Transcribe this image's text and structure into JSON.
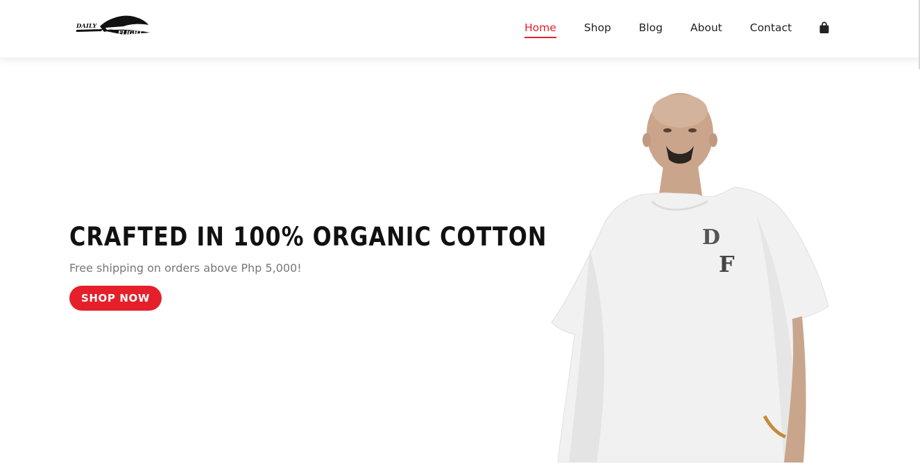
{
  "brand": {
    "logo_line1": "DAILY",
    "logo_line2": "FLIGHT",
    "logo_mark": "wing-logo"
  },
  "nav": {
    "items": [
      {
        "label": "Home",
        "active": true
      },
      {
        "label": "Shop",
        "active": false
      },
      {
        "label": "Blog",
        "active": false
      },
      {
        "label": "About",
        "active": false
      },
      {
        "label": "Contact",
        "active": false
      }
    ],
    "cart_icon": "shopping-bag-icon"
  },
  "hero": {
    "headline": "CRAFTED IN 100% ORGANIC COTTON",
    "subtitle": "Free shipping on orders above Php 5,000!",
    "cta_label": "SHOP NOW",
    "image": "model-wearing-white-tshirt"
  },
  "colors": {
    "accent": "#e5202a",
    "text": "#111111",
    "muted": "#777777",
    "background": "#ffffff"
  }
}
